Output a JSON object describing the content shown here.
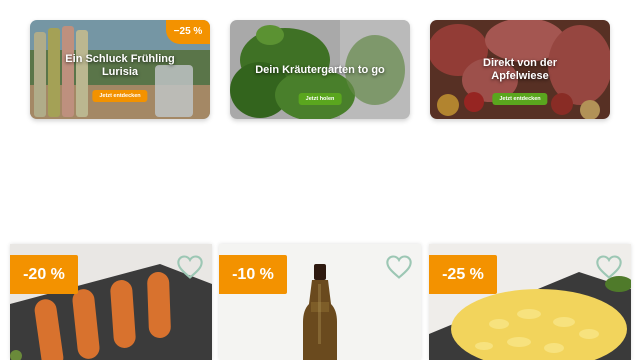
{
  "banners": [
    {
      "title": "Ein Schluck Frühling Lurisia",
      "cta": "Jetzt entdecken",
      "badge": "−25 %",
      "accent": "#f39200"
    },
    {
      "title": "Dein Kräutergarten to go",
      "cta": "Jetzt holen",
      "accent": "#5aa61e"
    },
    {
      "title": "Direkt von der Apfelwiese",
      "cta": "Jetzt entdecken",
      "accent": "#5aa61e"
    }
  ],
  "products": [
    {
      "discount": "-20 %",
      "icon": "heart-outline-icon",
      "image": "sausages-on-slate"
    },
    {
      "discount": "-10 %",
      "icon": "heart-outline-icon",
      "image": "bottle"
    },
    {
      "discount": "-25 %",
      "icon": "heart-outline-icon",
      "image": "spaetzle-on-slate"
    }
  ],
  "colors": {
    "orange": "#f39200",
    "green": "#5aa61e",
    "heart": "#9cc7b4"
  }
}
